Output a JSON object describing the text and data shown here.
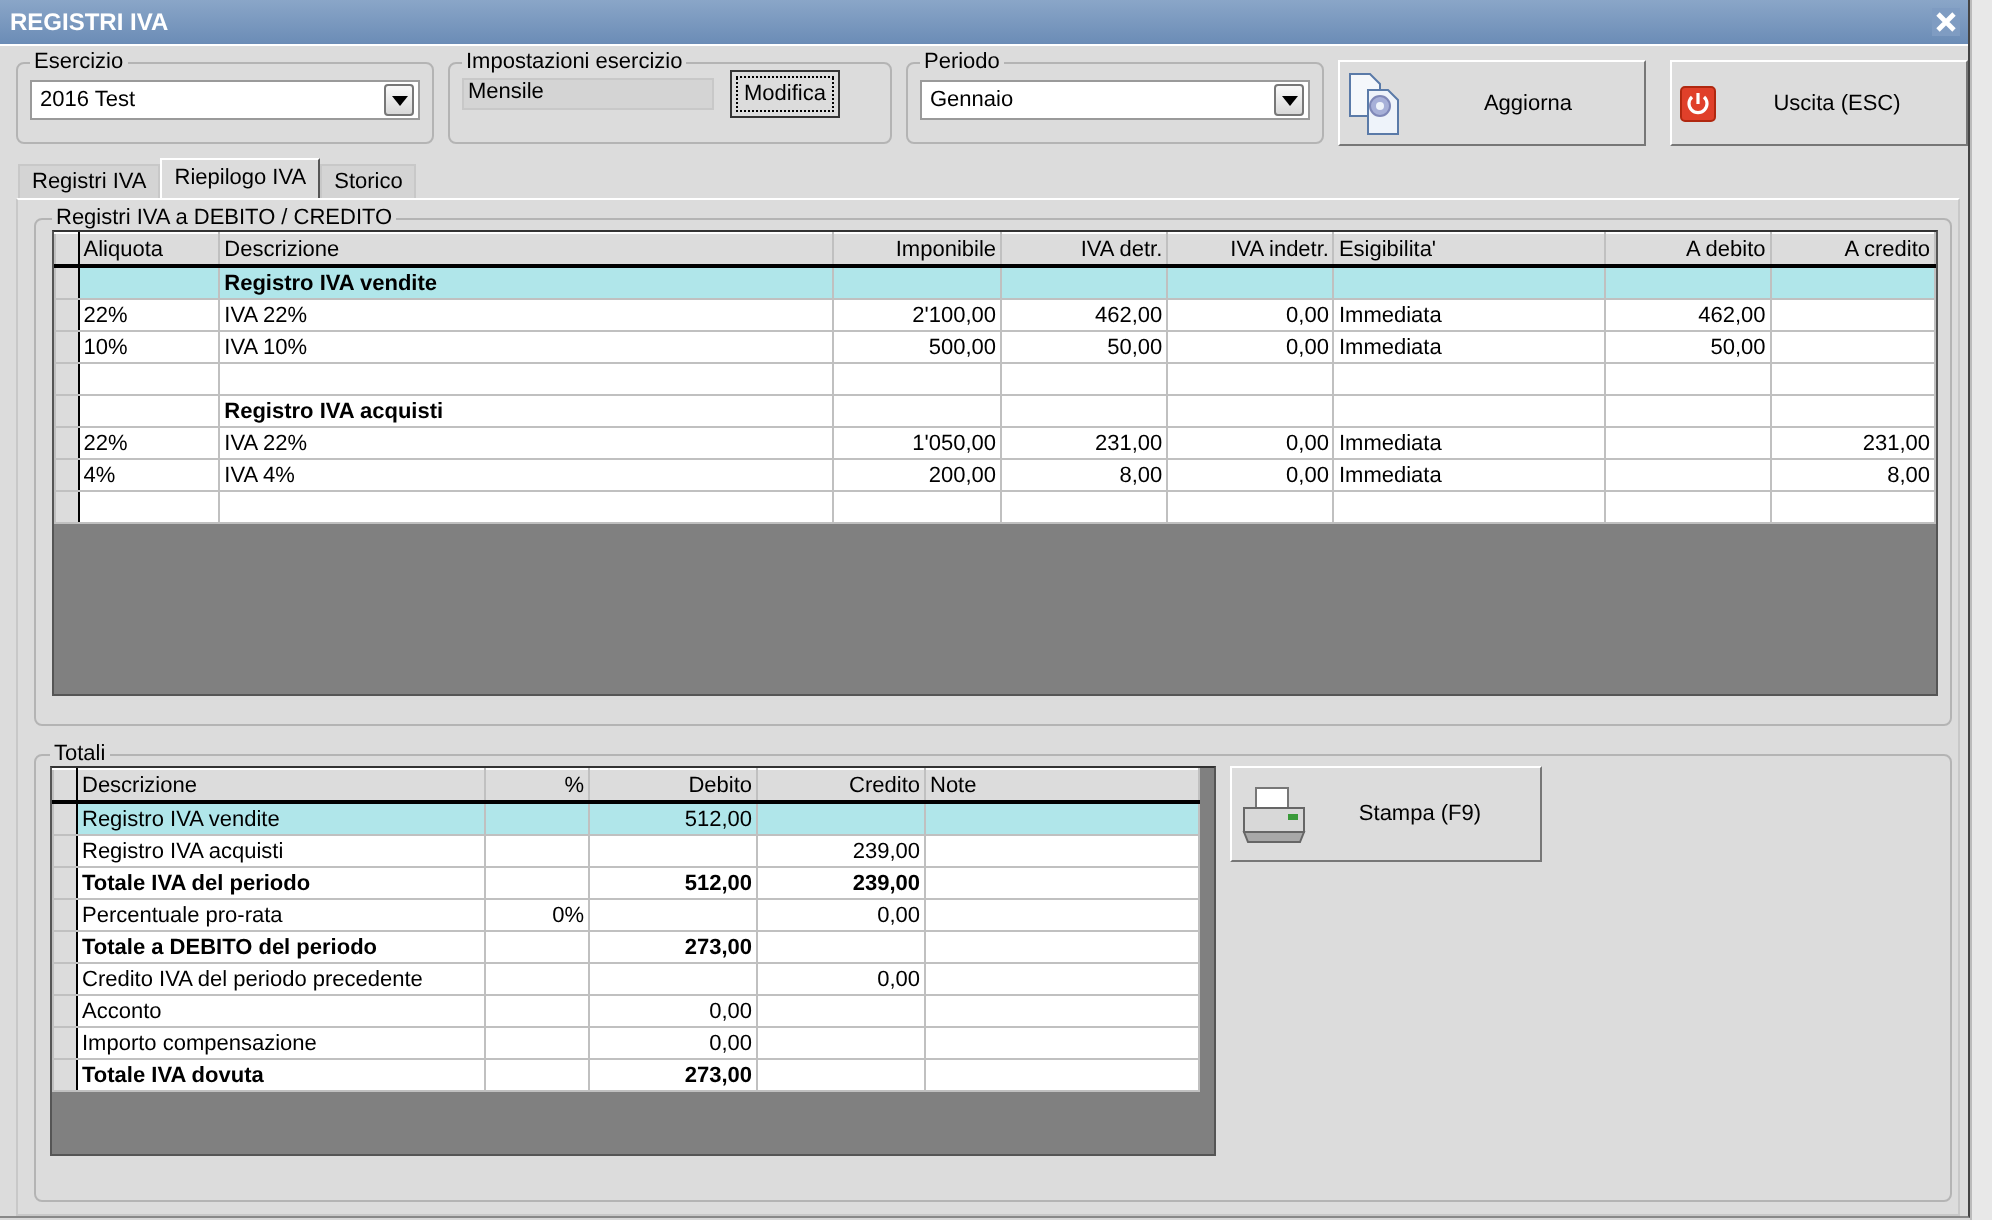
{
  "window": {
    "title": "REGISTRI IVA"
  },
  "esercizio": {
    "label": "Esercizio",
    "value": "2016 Test"
  },
  "impostazioni": {
    "label": "Impostazioni esercizio",
    "value": "Mensile",
    "button": "Modifica"
  },
  "periodo": {
    "label": "Periodo",
    "value": "Gennaio"
  },
  "actions": [
    {
      "label": "Aggiorna",
      "kind": "refresh"
    },
    {
      "label": "Uscita (ESC)",
      "kind": "exit"
    }
  ],
  "tabs": [
    {
      "label": "Registri IVA",
      "selected": false
    },
    {
      "label": "Riepilogo IVA",
      "selected": true
    },
    {
      "label": "Storico",
      "selected": false
    }
  ],
  "registri": {
    "title": "Registri IVA a DEBITO / CREDITO",
    "columns": [
      "Aliquota",
      "Descrizione",
      "Imponibile",
      "IVA detr.",
      "IVA indetr.",
      "Esigibilita'",
      "A debito",
      "A credito"
    ],
    "rows": [
      {
        "kind": "section",
        "selected": true,
        "cells": [
          null,
          "Registro IVA vendite",
          null,
          null,
          null,
          null,
          null,
          null
        ]
      },
      {
        "kind": "line",
        "selected": false,
        "cells": [
          "22%",
          "IVA 22%",
          "2'100,00",
          "462,00",
          "0,00",
          "Immediata",
          "462,00",
          null
        ]
      },
      {
        "kind": "line",
        "selected": false,
        "cells": [
          "10%",
          "IVA 10%",
          "500,00",
          "50,00",
          "0,00",
          "Immediata",
          "50,00",
          null
        ]
      },
      {
        "kind": "blank",
        "selected": false,
        "cells": [
          null,
          null,
          null,
          null,
          null,
          null,
          null,
          null
        ]
      },
      {
        "kind": "section",
        "selected": false,
        "cells": [
          null,
          "Registro IVA acquisti",
          null,
          null,
          null,
          null,
          null,
          null
        ]
      },
      {
        "kind": "line",
        "selected": false,
        "cells": [
          "22%",
          "IVA 22%",
          "1'050,00",
          "231,00",
          "0,00",
          "Immediata",
          null,
          "231,00"
        ]
      },
      {
        "kind": "line",
        "selected": false,
        "cells": [
          "4%",
          "IVA 4%",
          "200,00",
          "8,00",
          "0,00",
          "Immediata",
          null,
          "8,00"
        ]
      },
      {
        "kind": "blank",
        "selected": false,
        "cells": [
          null,
          null,
          null,
          null,
          null,
          null,
          null,
          null
        ]
      }
    ]
  },
  "totali": {
    "title": "Totali",
    "columns": [
      "Descrizione",
      "%",
      "Debito",
      "Credito",
      "Note"
    ],
    "rows": [
      {
        "kind": "line",
        "selected": true,
        "cells": [
          "Registro IVA vendite",
          null,
          "512,00",
          null,
          null
        ]
      },
      {
        "kind": "line",
        "selected": false,
        "cells": [
          "Registro IVA acquisti",
          null,
          null,
          "239,00",
          null
        ]
      },
      {
        "kind": "total",
        "selected": false,
        "cells": [
          "Totale IVA del periodo",
          null,
          "512,00",
          "239,00",
          null
        ]
      },
      {
        "kind": "line",
        "selected": false,
        "cells": [
          "Percentuale pro-rata",
          "0%",
          null,
          "0,00",
          null
        ]
      },
      {
        "kind": "total",
        "selected": false,
        "cells": [
          "Totale a DEBITO del periodo",
          null,
          "273,00",
          null,
          null
        ]
      },
      {
        "kind": "line",
        "selected": false,
        "cells": [
          "Credito IVA del periodo precedente",
          null,
          null,
          "0,00",
          null
        ]
      },
      {
        "kind": "line",
        "selected": false,
        "cells": [
          "Acconto",
          null,
          "0,00",
          null,
          null
        ]
      },
      {
        "kind": "line",
        "selected": false,
        "cells": [
          "Importo compensazione",
          null,
          "0,00",
          null,
          null
        ]
      },
      {
        "kind": "total",
        "selected": false,
        "cells": [
          "Totale IVA dovuta",
          null,
          "273,00",
          null,
          null
        ]
      }
    ],
    "print_button": "Stampa (F9)"
  }
}
